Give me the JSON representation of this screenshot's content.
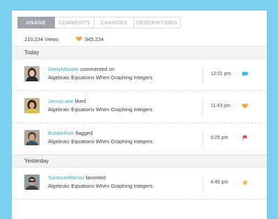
{
  "tabs": [
    {
      "label": "Usage",
      "active": true
    },
    {
      "label": "Comments",
      "active": false
    },
    {
      "label": "Changes",
      "active": false
    },
    {
      "label": "Descriptions",
      "active": false
    }
  ],
  "stats": {
    "views_count": "210,234",
    "views_label": "Views",
    "favorites_count": "345,234"
  },
  "sections": [
    {
      "label": "Today",
      "items": [
        {
          "user": "GerryMander",
          "action": "commented on",
          "target": "Algebraic Equations When Graphing Integers",
          "time": "12:01 pm",
          "icon": "comment-icon"
        },
        {
          "user": "JennyLane",
          "action": "liked",
          "target": "Algebraic Equations When Graphing Integers",
          "time": "11:43 pm",
          "icon": "heart-icon"
        },
        {
          "user": "BubbleFish",
          "action": "flagged",
          "target": "Algebraic Equations When Graphing Integers",
          "time": "9:25 pm",
          "icon": "flag-icon"
        }
      ]
    },
    {
      "label": "Yesterday",
      "items": [
        {
          "user": "SamuraiWarrior",
          "action": "favorited",
          "target": "Algebraic Equations When Graphing Integers",
          "time": "4:45 pm",
          "icon": "star-icon"
        }
      ]
    }
  ],
  "colors": {
    "background": "#7dcfee",
    "accent_link": "#3aa7c9",
    "heart": "#f0a640",
    "comment": "#3cb4e0",
    "flag": "#e0433a",
    "star": "#f2b530",
    "active_tab": "#9ea4a9"
  }
}
